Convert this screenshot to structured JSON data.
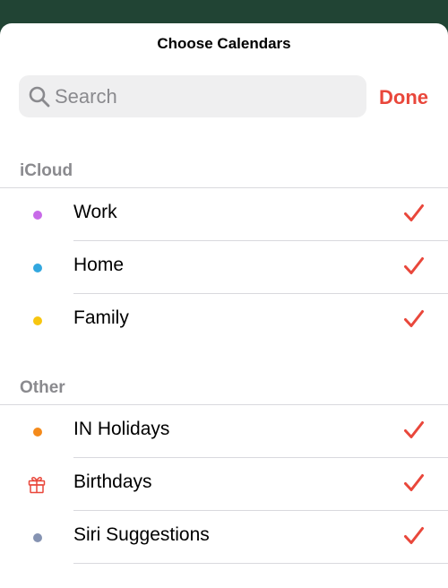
{
  "header": {
    "title": "Choose Calendars"
  },
  "search": {
    "placeholder": "Search",
    "value": "",
    "done_label": "Done"
  },
  "sections": [
    {
      "title": "iCloud",
      "items": [
        {
          "label": "Work",
          "icon": "dot",
          "color": "#c86ae8",
          "checked": true
        },
        {
          "label": "Home",
          "icon": "dot",
          "color": "#32a7df",
          "checked": true
        },
        {
          "label": "Family",
          "icon": "dot",
          "color": "#f7c610",
          "checked": true
        }
      ]
    },
    {
      "title": "Other",
      "items": [
        {
          "label": "IN Holidays",
          "icon": "dot",
          "color": "#f48a1b",
          "checked": true
        },
        {
          "label": "Birthdays",
          "icon": "gift-icon",
          "color": "#e9473b",
          "checked": true
        },
        {
          "label": "Siri Suggestions",
          "icon": "dot",
          "color": "#8593b2",
          "checked": true
        }
      ]
    }
  ],
  "colors": {
    "accent": "#e9473b",
    "background": "#214434"
  }
}
